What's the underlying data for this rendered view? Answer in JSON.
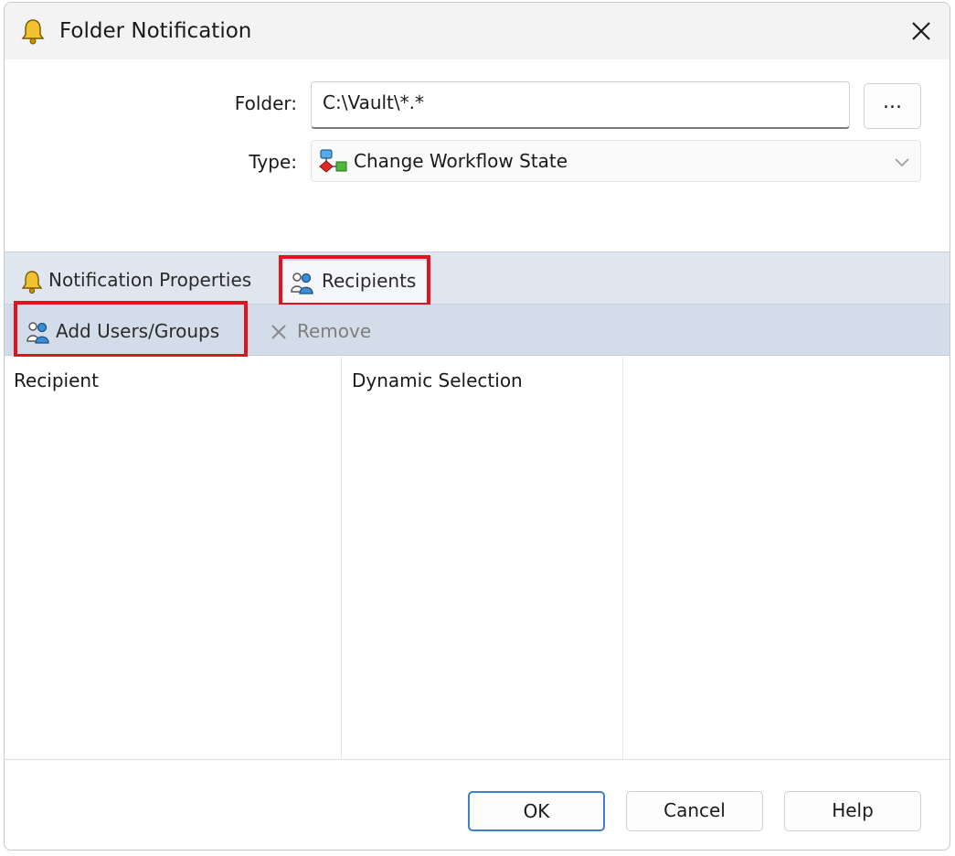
{
  "window": {
    "title": "Folder Notification"
  },
  "form": {
    "folder_label": "Folder:",
    "folder_value": "C:\\Vault\\*.*",
    "browse_label": "...",
    "type_label": "Type:",
    "type_value": "Change Workflow State"
  },
  "tabs": [
    {
      "label": "Notification Properties",
      "icon": "bell-icon",
      "active": false
    },
    {
      "label": "Recipients",
      "icon": "users-icon",
      "active": true
    }
  ],
  "toolbar": {
    "add_label": "Add Users/Groups",
    "remove_label": "Remove"
  },
  "list": {
    "columns": [
      "Recipient",
      "Dynamic Selection"
    ],
    "rows": []
  },
  "buttons": {
    "ok": "OK",
    "cancel": "Cancel",
    "help": "Help"
  },
  "colors": {
    "highlight": "#e0141f",
    "tab_strip": "#dfe6ef",
    "toolbar": "#d3dde9",
    "ok_border": "#3f7ec9"
  }
}
